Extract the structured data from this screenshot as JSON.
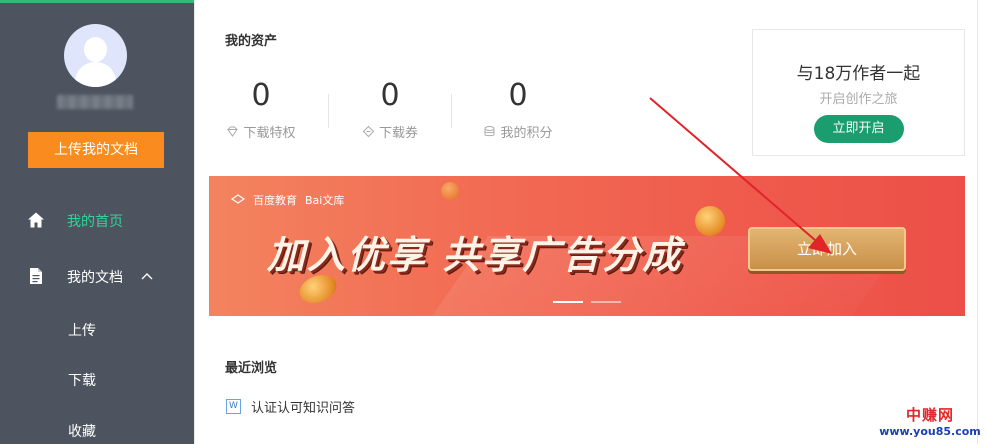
{
  "sidebar": {
    "upload_button": "上传我的文档",
    "nav": {
      "home": "我的首页",
      "docs": "我的文档"
    },
    "sub_items": [
      "上传",
      "下载",
      "收藏"
    ],
    "colors": {
      "background": "#4d545f",
      "accent": "#33d29a",
      "upload": "#fa8c1f"
    }
  },
  "assets": {
    "title": "我的资产",
    "stats": [
      {
        "value": "0",
        "label": "下载特权",
        "icon": "diamond-icon"
      },
      {
        "value": "0",
        "label": "下载券",
        "icon": "ticket-icon"
      },
      {
        "value": "0",
        "label": "我的积分",
        "icon": "coins-icon"
      }
    ]
  },
  "promo": {
    "headline": "与18万作者一起",
    "subline": "开启创作之旅",
    "button": "立即开启"
  },
  "banner": {
    "brand_edu": "百度教育",
    "brand_wenku": "Bai文库",
    "headline": "加入优享 共享广告分成",
    "button": "立即加入"
  },
  "recent": {
    "title": "最近浏览",
    "items": [
      {
        "icon": "W",
        "title": "认证认可知识问答"
      }
    ]
  },
  "watermark": {
    "name": "中赚网",
    "url": "www.you85.com"
  }
}
